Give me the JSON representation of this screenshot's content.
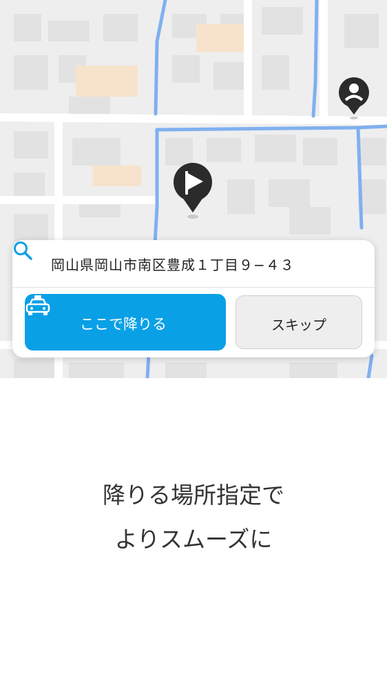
{
  "map": {
    "pins": [
      {
        "name": "destination-flag-pin"
      },
      {
        "name": "user-location-pin"
      }
    ]
  },
  "address_card": {
    "search_icon": "search-icon",
    "address": "岡山県岡山市南区豊成１丁目９−４３",
    "primary_button": {
      "icon": "taxi-icon",
      "label": "ここで降りる"
    },
    "skip_button": {
      "label": "スキップ"
    },
    "accent_color": "#0aa0e6"
  },
  "caption": {
    "line1": "降りる場所指定で",
    "line2": "よりスムーズに"
  }
}
